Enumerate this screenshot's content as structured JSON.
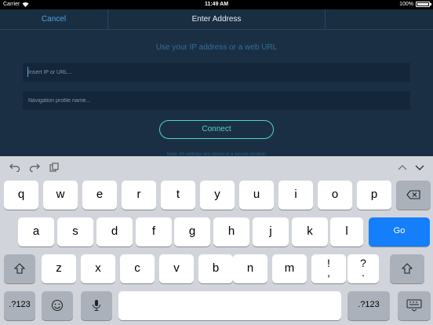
{
  "status": {
    "carrier": "Carrier",
    "time": "11:49 AM",
    "battery": "100%"
  },
  "nav": {
    "cancel": "Cancel",
    "title": "Enter Address"
  },
  "form": {
    "hint": "Use your IP address or a web URL",
    "ip_placeholder": "Insert IP or URL...",
    "profile_placeholder": "Navigation profile name...",
    "connect": "Connect",
    "faint_text": "Note: All settings are stored in a secure location"
  },
  "keyboard": {
    "row1": [
      "q",
      "w",
      "e",
      "r",
      "t",
      "y",
      "u",
      "i",
      "o",
      "p"
    ],
    "row2": [
      "a",
      "s",
      "d",
      "f",
      "g",
      "h",
      "j",
      "k",
      "l"
    ],
    "row3": [
      "z",
      "x",
      "c",
      "v",
      "b",
      "n",
      "m"
    ],
    "go": "Go",
    "numbers": ".?123",
    "punct1": [
      "!",
      ","
    ],
    "punct2": [
      "?",
      "."
    ]
  },
  "colors": {
    "accent": "#4fd6c7",
    "link": "#4da3e0",
    "go_key": "#147efb",
    "background": "#1b2f44"
  }
}
